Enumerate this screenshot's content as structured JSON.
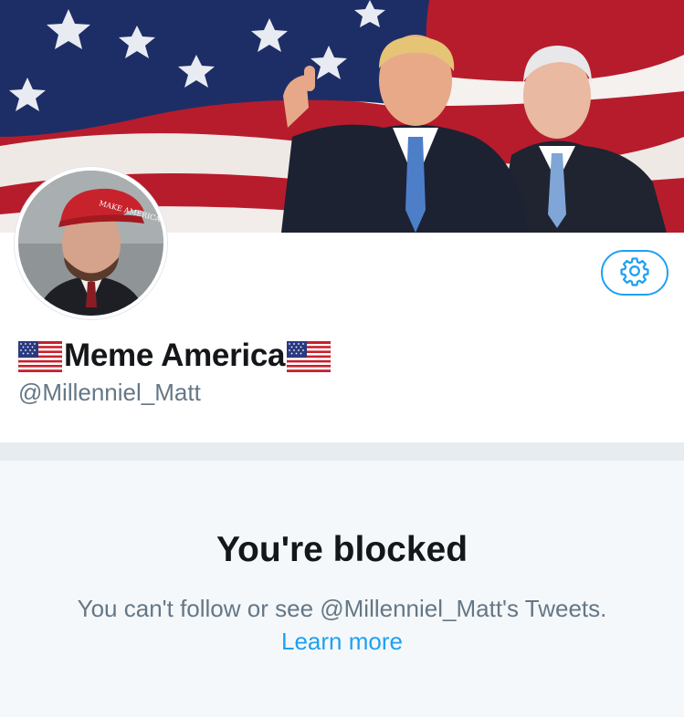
{
  "profile": {
    "display_name": "Meme America",
    "flag_emoji": "us-flag-icon",
    "handle": "@Millenniel_Matt"
  },
  "settings": {
    "icon": "gear-icon"
  },
  "blocked": {
    "title": "You're blocked",
    "message": "You can't follow or see @Millenniel_Matt's Tweets.",
    "learn_more": "Learn more"
  },
  "colors": {
    "accent": "#1da1f2",
    "text_primary": "#14171a",
    "text_secondary": "#657786",
    "divider": "#e6ecf0",
    "blocked_bg": "#f5f8fa"
  }
}
